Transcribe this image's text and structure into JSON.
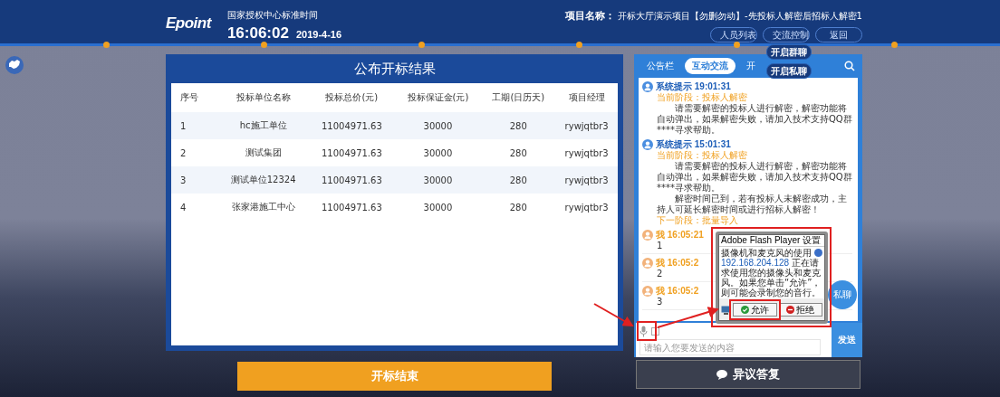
{
  "header": {
    "logo": "Epoint",
    "clock_label": "国家授权中心标准时间",
    "time": "16:06:02",
    "date": "2019-4-16",
    "project_label": "项目名称：",
    "project_name": "开标大厅演示项目【勿删勿动】-先投标人解密后招标人解密1",
    "buttons": [
      "人员列表",
      "交流控制",
      "返回"
    ]
  },
  "control_menu": [
    "开启群聊",
    "开启私聊"
  ],
  "results": {
    "title": "公布开标结果",
    "columns": [
      "序号",
      "投标单位名称",
      "投标总价(元)",
      "投标保证金(元)",
      "工期(日历天)",
      "项目经理"
    ],
    "rows": [
      [
        "1",
        "hc施工单位",
        "11004971.63",
        "30000",
        "280",
        "rywjqtbr3"
      ],
      [
        "2",
        "测试集团",
        "11004971.63",
        "30000",
        "280",
        "rywjqtbr3"
      ],
      [
        "3",
        "测试单位12324",
        "11004971.63",
        "30000",
        "280",
        "rywjqtbr3"
      ],
      [
        "4",
        "张家港施工中心",
        "11004971.63",
        "30000",
        "280",
        "rywjqtbr3"
      ]
    ]
  },
  "end_button": "开标结束",
  "chat": {
    "tabs": [
      {
        "label": "公告栏",
        "selected": false
      },
      {
        "label": "互动交流",
        "selected": true
      },
      {
        "label": "开",
        "selected": false
      }
    ],
    "messages": [
      {
        "kind": "system",
        "sender": "系统提示",
        "time": "19:01:31",
        "stage": "当前阶段：投标人解密",
        "paragraphs": [
          "请需要解密的投标人进行解密，解密功能将自动弹出，如果解密失败，请加入技术支持QQ群****寻求帮助。"
        ]
      },
      {
        "kind": "system",
        "sender": "系统提示",
        "time": "15:01:31",
        "stage": "当前阶段：投标人解密",
        "paragraphs": [
          "请需要解密的投标人进行解密，解密功能将自动弹出，如果解密失败，请加入技术支持QQ群****寻求帮助。",
          "解密时间已到，若有投标人未解密成功，主持人可延长解密时间或进行招标人解密！"
        ],
        "next_stage": "下一阶段：批量导入"
      },
      {
        "kind": "self",
        "sender": "我",
        "time": "16:05:21",
        "text": "1"
      },
      {
        "kind": "self",
        "sender": "我",
        "time": "16:05:2",
        "text": "2"
      },
      {
        "kind": "self",
        "sender": "我",
        "time": "16:05:2",
        "text": "3"
      }
    ],
    "private_button": "私聊",
    "input_placeholder": "请输入您要发送的内容",
    "send_button": "发送"
  },
  "objection_button": "异议答复",
  "flash_dialog": {
    "title": "Adobe Flash Player 设置",
    "heading": "摄像机和麦克风的使用",
    "address": "192.168.204.128",
    "message": "正在请求使用您的摄像头和麦克风。如果您单击“允许”，则可能会录制您的音行。",
    "buttons": [
      {
        "label": "允许",
        "kind": "allow"
      },
      {
        "label": "拒绝",
        "kind": "deny"
      }
    ]
  }
}
